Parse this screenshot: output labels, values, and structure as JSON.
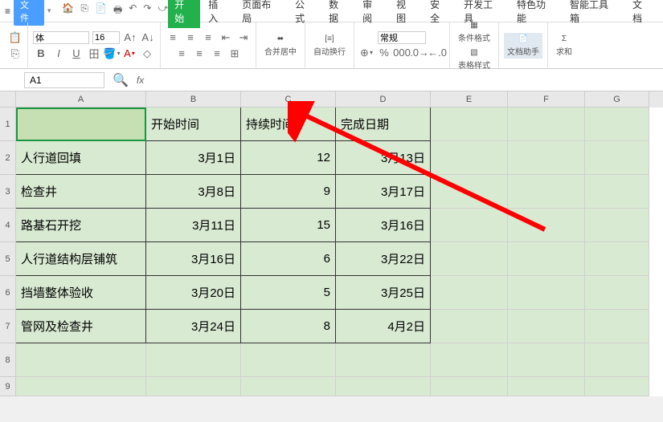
{
  "menubar": {
    "menu_icon": "≡",
    "file_label": "文件",
    "qat": [
      "🏠",
      "⎘",
      "📄",
      "🖶",
      "↶",
      "↷",
      "⤻"
    ],
    "tabs": [
      "开始",
      "插入",
      "页面布局",
      "公式",
      "数据",
      "审阅",
      "视图",
      "安全",
      "开发工具",
      "特色功能",
      "智能工具箱",
      "文档"
    ]
  },
  "ribbon": {
    "font_name": "体",
    "font_size": "16",
    "merge_label": "合并居中",
    "wrap_label": "自动换行",
    "number_format": "常规",
    "cond_fmt": "条件格式",
    "table_style": "表格样式",
    "doc_helper": "文档助手",
    "sum": "求和"
  },
  "namebox": {
    "value": "A1"
  },
  "columns": [
    "A",
    "B",
    "C",
    "D",
    "E",
    "F",
    "G"
  ],
  "rows": [
    "1",
    "2",
    "3",
    "4",
    "5",
    "6",
    "7",
    "8",
    "9"
  ],
  "table": {
    "headers": {
      "b": "开始时间",
      "c": "持续时间",
      "d": "完成日期"
    },
    "data": [
      {
        "a": "人行道回填",
        "b": "3月1日",
        "c": "12",
        "d": "3月13日"
      },
      {
        "a": "检查井",
        "b": "3月8日",
        "c": "9",
        "d": "3月17日"
      },
      {
        "a": "路基石开挖",
        "b": "3月11日",
        "c": "15",
        "d": "3月16日"
      },
      {
        "a": "人行道结构层铺筑",
        "b": "3月16日",
        "c": "6",
        "d": "3月22日"
      },
      {
        "a": "挡墙整体验收",
        "b": "3月20日",
        "c": "5",
        "d": "3月25日"
      },
      {
        "a": "管网及检查井",
        "b": "3月24日",
        "c": "8",
        "d": "4月2日"
      }
    ]
  }
}
